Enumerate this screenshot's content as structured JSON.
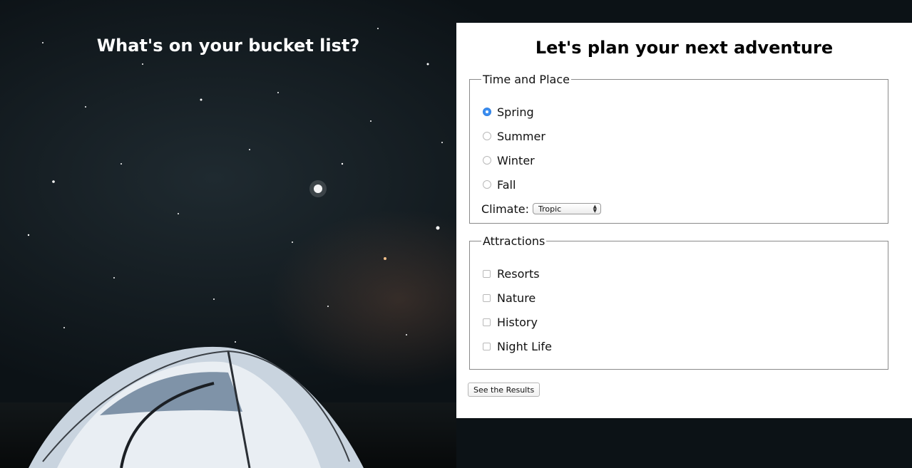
{
  "left": {
    "heading": "What's on your bucket list?"
  },
  "form": {
    "heading": "Let's plan your next adventure",
    "time_place": {
      "legend": "Time and Place",
      "seasons": [
        {
          "label": "Spring",
          "checked": true
        },
        {
          "label": "Summer",
          "checked": false
        },
        {
          "label": "Winter",
          "checked": false
        },
        {
          "label": "Fall",
          "checked": false
        }
      ],
      "climate_label": "Climate:",
      "climate_value": "Tropic"
    },
    "attractions": {
      "legend": "Attractions",
      "items": [
        {
          "label": "Resorts",
          "checked": false
        },
        {
          "label": "Nature",
          "checked": false
        },
        {
          "label": "History",
          "checked": false
        },
        {
          "label": "Night Life",
          "checked": false
        }
      ]
    },
    "submit_label": "See the Results"
  },
  "colors": {
    "radio_checked": "#3b8ef1",
    "panel_bg": "#ffffff"
  }
}
